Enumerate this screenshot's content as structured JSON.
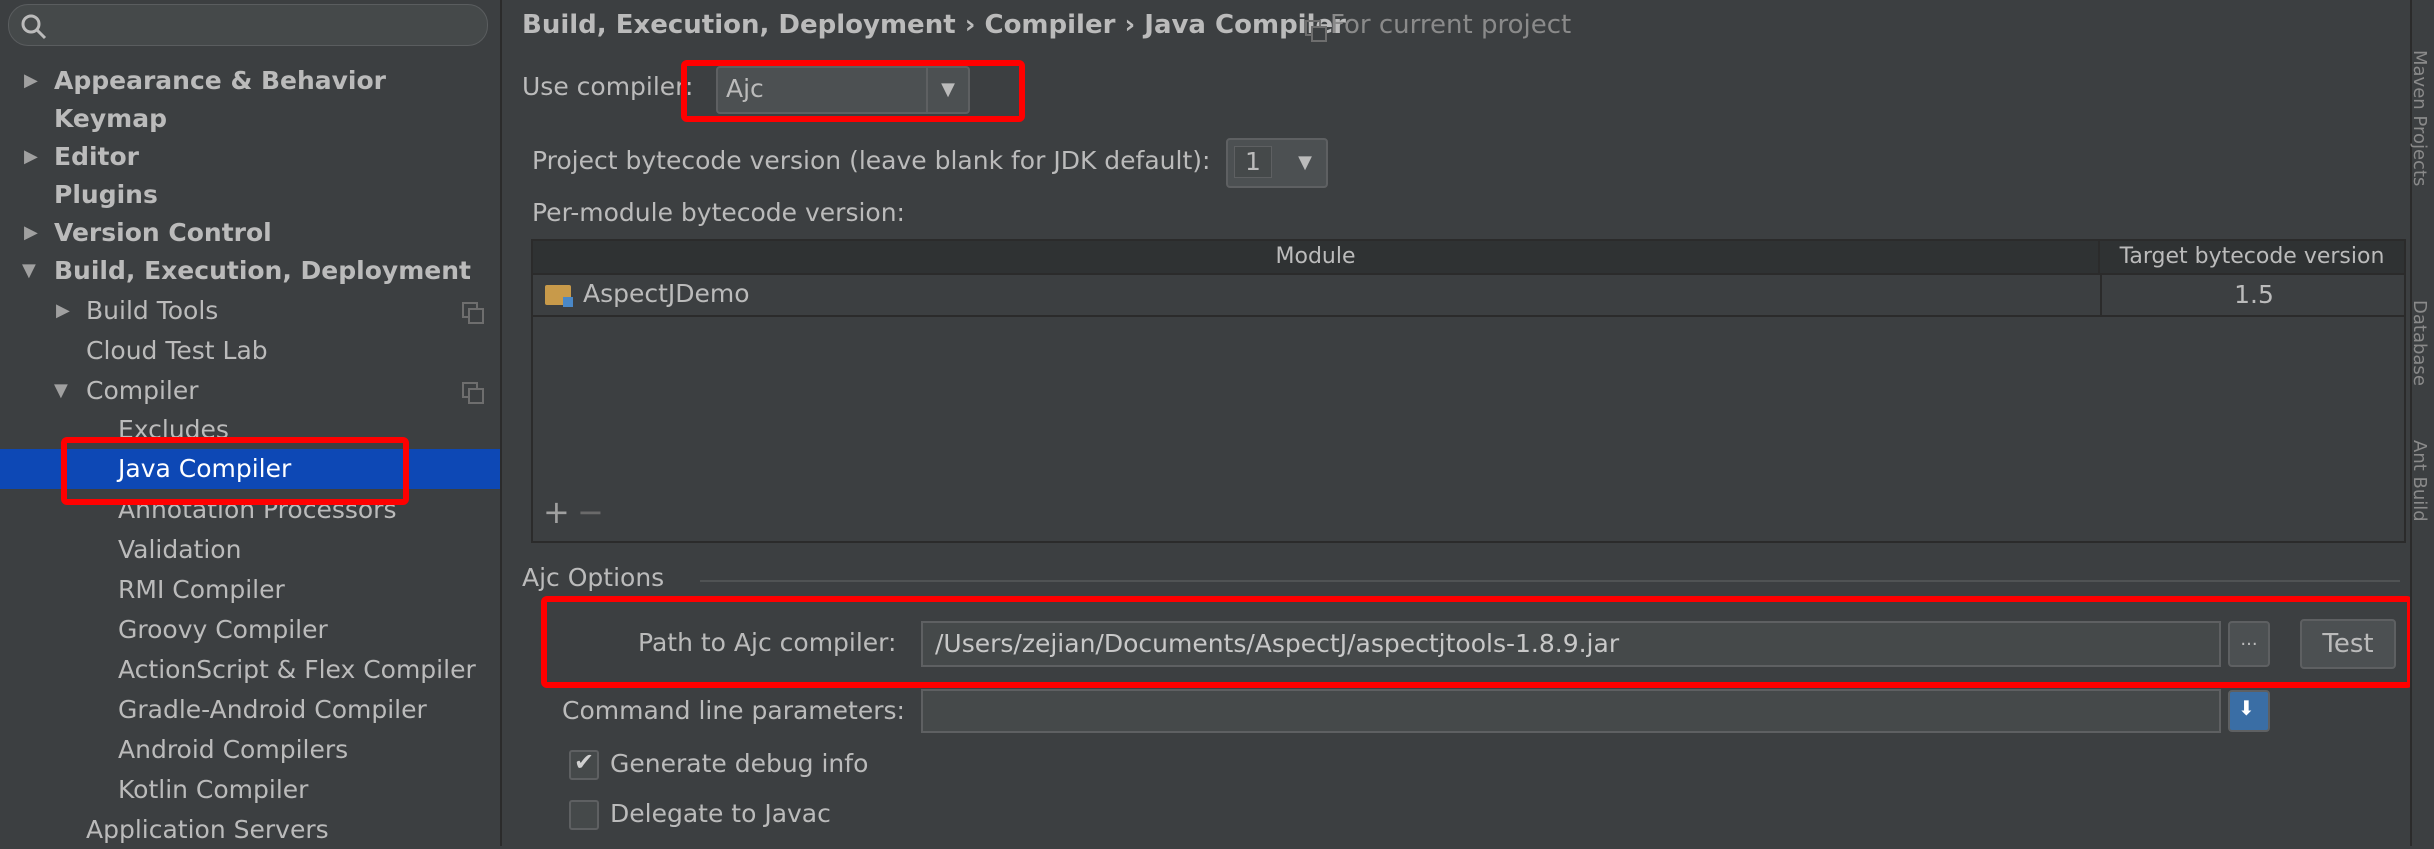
{
  "sidebar": {
    "search_placeholder": "",
    "items": [
      {
        "label": "Appearance & Behavior"
      },
      {
        "label": "Keymap"
      },
      {
        "label": "Editor"
      },
      {
        "label": "Plugins"
      },
      {
        "label": "Version Control"
      },
      {
        "label": "Build, Execution, Deployment"
      },
      {
        "label": "Build Tools"
      },
      {
        "label": "Cloud Test Lab"
      },
      {
        "label": "Compiler"
      },
      {
        "label": "Excludes"
      },
      {
        "label": "Java Compiler"
      },
      {
        "label": "Annotation Processors"
      },
      {
        "label": "Validation"
      },
      {
        "label": "RMI Compiler"
      },
      {
        "label": "Groovy Compiler"
      },
      {
        "label": "ActionScript & Flex Compiler"
      },
      {
        "label": "Gradle-Android Compiler"
      },
      {
        "label": "Android Compilers"
      },
      {
        "label": "Kotlin Compiler"
      },
      {
        "label": "Application Servers"
      }
    ]
  },
  "breadcrumb": {
    "part1": "Build, Execution, Deployment",
    "sep": "›",
    "part2": "Compiler",
    "part3": "Java Compiler",
    "scope": "For current project"
  },
  "compiler": {
    "use_compiler_label": "Use compiler:",
    "use_compiler_value": "Ajc",
    "project_bytecode_label": "Project bytecode version (leave blank for JDK default):",
    "project_bytecode_value": "1",
    "per_module_label": "Per-module bytecode version:"
  },
  "module_table": {
    "headers": [
      "Module",
      "Target bytecode version"
    ],
    "rows": [
      {
        "module": "AspectJDemo",
        "version": "1.5"
      }
    ],
    "add": "+",
    "remove": "−"
  },
  "ajc": {
    "section_title": "Ajc Options",
    "path_label": "Path to Ajc compiler:",
    "path_value": "/Users/zejian/Documents/AspectJ/aspectjtools-1.8.9.jar",
    "browse": "...",
    "test_button": "Test",
    "cmd_label": "Command line parameters:",
    "cmd_value": "",
    "debug_label": "Generate debug info",
    "debug_checked": true,
    "delegate_label": "Delegate to Javac",
    "delegate_checked": false
  },
  "right_strip": [
    "Maven Projects",
    "Database",
    "Ant Build"
  ],
  "colors": {
    "selection": "#0d48b5",
    "highlight": "#ff0000",
    "background": "#3c3f41"
  }
}
